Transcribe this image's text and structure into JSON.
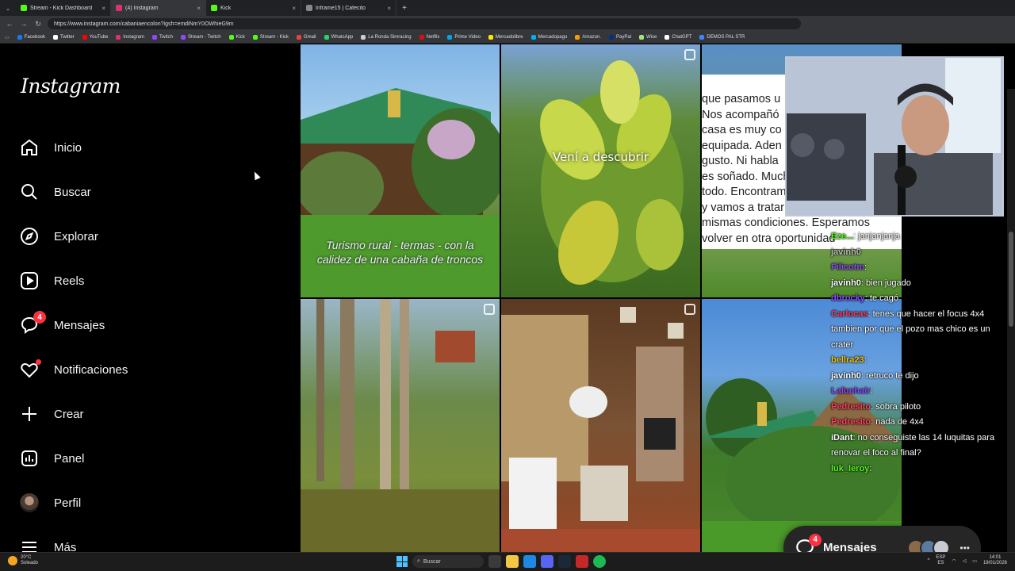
{
  "browser": {
    "tabs": [
      {
        "title": "Stream - Kick Dashboard",
        "color": "#53fc18",
        "active": false
      },
      {
        "title": "(4) Instagram",
        "color": "#e1306c",
        "active": true
      },
      {
        "title": "Kick",
        "color": "#53fc18",
        "active": false
      },
      {
        "title": "Inframe15 | Cafecito",
        "color": "#888888",
        "active": false
      }
    ],
    "url": "https://www.instagram.com/cabaniaencolon?igsh=emdiNmY0OWhieG9m",
    "bookmarks": [
      {
        "label": "Facebook",
        "color": "#1877f2"
      },
      {
        "label": "Twitter",
        "color": "#ffffff"
      },
      {
        "label": "YouTube",
        "color": "#ff0000"
      },
      {
        "label": "Instagram",
        "color": "#e1306c"
      },
      {
        "label": "Twitch",
        "color": "#9146ff"
      },
      {
        "label": "Stream - Twitch",
        "color": "#9146ff"
      },
      {
        "label": "Kick",
        "color": "#53fc18"
      },
      {
        "label": "Stream - Kick",
        "color": "#53fc18"
      },
      {
        "label": "Gmail",
        "color": "#ea4335"
      },
      {
        "label": "WhatsApp",
        "color": "#25d366"
      },
      {
        "label": "La Ronda Simracing",
        "color": "#cccccc"
      },
      {
        "label": "Netflix",
        "color": "#e50914"
      },
      {
        "label": "Prime Video",
        "color": "#00a8e1"
      },
      {
        "label": "Mercadolibre",
        "color": "#ffe600"
      },
      {
        "label": "Mercadopago",
        "color": "#00b1ea"
      },
      {
        "label": "Amazon.",
        "color": "#ff9900"
      },
      {
        "label": "PayPal",
        "color": "#003087"
      },
      {
        "label": "Wise",
        "color": "#9fe870"
      },
      {
        "label": "ChatGPT",
        "color": "#ffffff"
      },
      {
        "label": "DEMOS PAL STR",
        "color": "#4285f4"
      }
    ]
  },
  "instagram": {
    "logo": "Instagram",
    "nav": {
      "inicio": "Inicio",
      "buscar": "Buscar",
      "explorar": "Explorar",
      "reels": "Reels",
      "mensajes": "Mensajes",
      "mensajes_badge": "4",
      "notificaciones": "Notificaciones",
      "crear": "Crear",
      "panel": "Panel",
      "perfil": "Perfil",
      "mas": "Más"
    },
    "posts": {
      "p1_overlay_line1": "Turismo rural - termas - con la",
      "p1_overlay_line2": "calidez de una cabaña de troncos",
      "p2_overlay": "Vení a descubrir",
      "p3_review": "que pasamos u\nNos acompañó\ncasa es muy co\nequipada. Aden\ngusto. Ni habla\nes soñado. Muchas gracias por\ntodo. Encontramos todo impecable\ny vamos a tratar de dejarla en las\nmismas condiciones. Esperamos\nvolver en otra oportunidad"
    },
    "messages_pill": {
      "label": "Mensajes",
      "badge": "4"
    }
  },
  "stream_chat": [
    {
      "user": "",
      "color": "#ffffff",
      "text": "",
      "badge": true
    },
    {
      "user": "Eze...",
      "color": "#53fc18",
      "text": ": janjanjanja"
    },
    {
      "user": "javinh0",
      "color": "#bbbbbb",
      "text": ""
    },
    {
      "user": "Filicotm",
      "color": "#9146ff",
      "text": ":"
    },
    {
      "user": "javinh0",
      "color": "#ffffff",
      "text": ": bien jugado"
    },
    {
      "user": "dbrocky",
      "color": "#9146ff",
      "text": ": te cagó"
    },
    {
      "user": "Carlocas",
      "color": "#ff4060",
      "text": ": tenes que hacer el focus 4x4 tambien por que el pozo mas chico es un crater",
      "wrap": true
    },
    {
      "user": "bellra23",
      "color": "#f0c419",
      "text": ":"
    },
    {
      "user": "javinh0",
      "color": "#ffffff",
      "text": ": retruco te dijo"
    },
    {
      "user": "Lalunhair",
      "color": "#9146ff",
      "text": ":"
    },
    {
      "user": "Pedresito",
      "color": "#ff4060",
      "text": ": sobra piloto"
    },
    {
      "user": "Pedresito",
      "color": "#ff4060",
      "text": ": nada de 4x4"
    },
    {
      "user": "iDant",
      "color": "#ffffff",
      "text": ": no conseguiste las 14 luquitas para renovar el foco al final?",
      "wrap": true
    },
    {
      "user": "luk_leroy",
      "color": "#53fc18",
      "text": ":"
    }
  ],
  "taskbar": {
    "weather_temp": "20°C",
    "weather_desc": "Soleado",
    "search_placeholder": "Buscar",
    "lang_line1": "ESP",
    "lang_line2": "ES",
    "time": "14:01",
    "date": "19/01/2026"
  }
}
